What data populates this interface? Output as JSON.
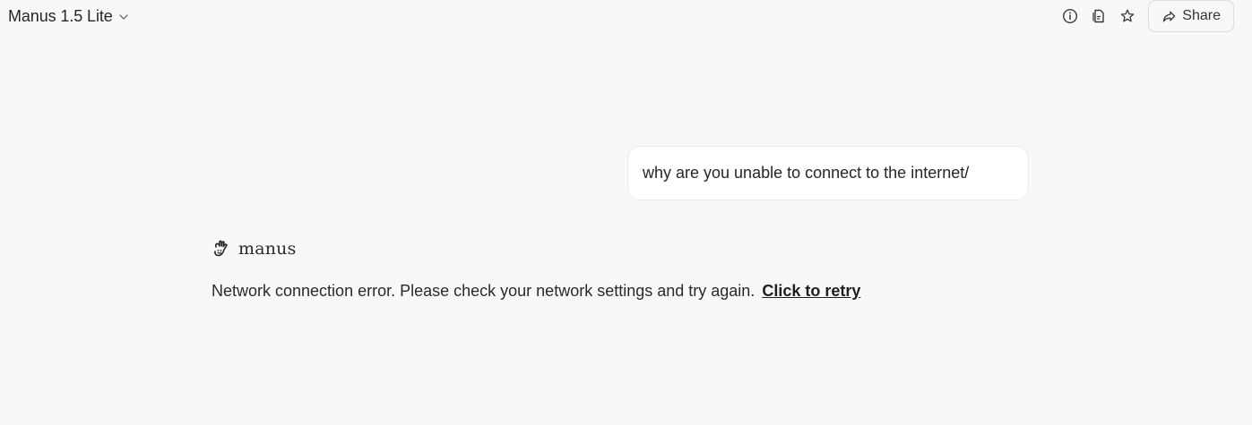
{
  "header": {
    "model_name": "Manus 1.5 Lite",
    "share_label": "Share",
    "icons": [
      "info-icon",
      "file-icon",
      "star-icon",
      "share-icon",
      "chevron-down-icon"
    ]
  },
  "conversation": {
    "user_message": "why are you unable to connect to the internet/",
    "assistant": {
      "brand": "manus",
      "error_text": "Network connection error. Please check your network settings and try again.",
      "retry_label": "Click to retry"
    }
  },
  "colors": {
    "background": "#f8f8f7",
    "bubble": "#ffffff",
    "text": "#262626",
    "border": "#dcdcda"
  }
}
